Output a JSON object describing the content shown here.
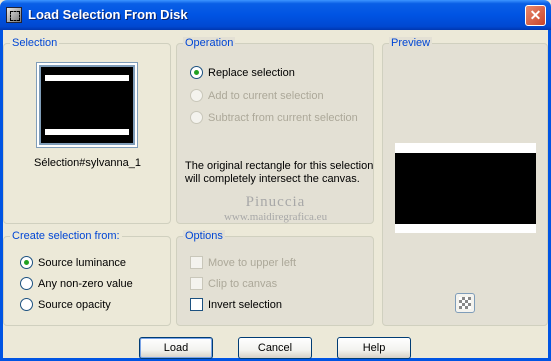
{
  "window": {
    "title": "Load Selection From Disk",
    "close_label": "✕"
  },
  "selection_group": {
    "legend": "Selection",
    "thumbnail_label": "Sélection#sylvanna_1"
  },
  "operation_group": {
    "legend": "Operation",
    "options": [
      {
        "label": "Replace selection",
        "checked": true,
        "enabled": true
      },
      {
        "label": "Add to current selection",
        "checked": false,
        "enabled": false
      },
      {
        "label": "Subtract from current selection",
        "checked": false,
        "enabled": false
      }
    ],
    "description": "The original rectangle for this selection will completely intersect the canvas."
  },
  "preview_group": {
    "legend": "Preview"
  },
  "create_group": {
    "legend": "Create selection from:",
    "options": [
      {
        "label": "Source luminance",
        "checked": true
      },
      {
        "label": "Any non-zero value",
        "checked": false
      },
      {
        "label": "Source opacity",
        "checked": false
      }
    ]
  },
  "options_group": {
    "legend": "Options",
    "items": [
      {
        "label": "Move to upper left",
        "checked": false,
        "enabled": false
      },
      {
        "label": "Clip to canvas",
        "checked": false,
        "enabled": false
      },
      {
        "label": "Invert selection",
        "checked": false,
        "enabled": true
      }
    ]
  },
  "watermark": {
    "line1": "Pinuccia",
    "line2": "www.maidiregrafica.eu"
  },
  "buttons": {
    "load": "Load",
    "cancel": "Cancel",
    "help": "Help"
  },
  "icons": {
    "app": "selection-icon",
    "close": "close-icon",
    "reset": "checkerboard-icon"
  },
  "colors": {
    "titlebar": "#0054e3",
    "legend": "#0046d5",
    "radio_dot": "#21a121",
    "dialog_bg": "#ece9d8"
  }
}
